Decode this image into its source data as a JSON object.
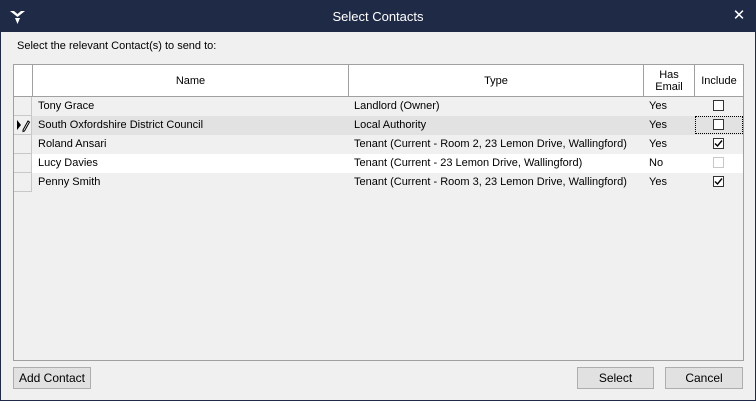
{
  "window": {
    "title": "Select Contacts"
  },
  "prompt": "Select the relevant Contact(s) to send to:",
  "columns": {
    "name": "Name",
    "type": "Type",
    "has_email_1": "Has",
    "has_email_2": "Email",
    "include": "Include"
  },
  "rows": [
    {
      "name": "Tony Grace",
      "type": "Landlord (Owner)",
      "has_email": "Yes",
      "include": false,
      "enabled": true,
      "selected": false,
      "editing": false,
      "bg": "#f0f0f0"
    },
    {
      "name": "South Oxfordshire District Council",
      "type": "Local Authority",
      "has_email": "Yes",
      "include": false,
      "enabled": true,
      "selected": true,
      "editing": true,
      "bg": "#e2e2e2"
    },
    {
      "name": "Roland Ansari",
      "type": "Tenant (Current - Room 2, 23 Lemon Drive, Wallingford)",
      "has_email": "Yes",
      "include": true,
      "enabled": true,
      "selected": false,
      "editing": false,
      "bg": "#f0f0f0"
    },
    {
      "name": "Lucy Davies",
      "type": "Tenant (Current - 23 Lemon Drive, Wallingford)",
      "has_email": "No",
      "include": false,
      "enabled": false,
      "selected": false,
      "editing": false,
      "bg": "#ffffff"
    },
    {
      "name": "Penny Smith",
      "type": "Tenant (Current - Room 3, 23 Lemon Drive, Wallingford)",
      "has_email": "Yes",
      "include": true,
      "enabled": true,
      "selected": false,
      "editing": false,
      "bg": "#f0f0f0"
    }
  ],
  "buttons": {
    "add_contact": "Add Contact",
    "select": "Select",
    "cancel": "Cancel"
  },
  "icons": {
    "app": "app-logo-icon",
    "close": "close-icon",
    "row_edit": "pencil-edit-icon",
    "check": "checkmark-icon"
  }
}
